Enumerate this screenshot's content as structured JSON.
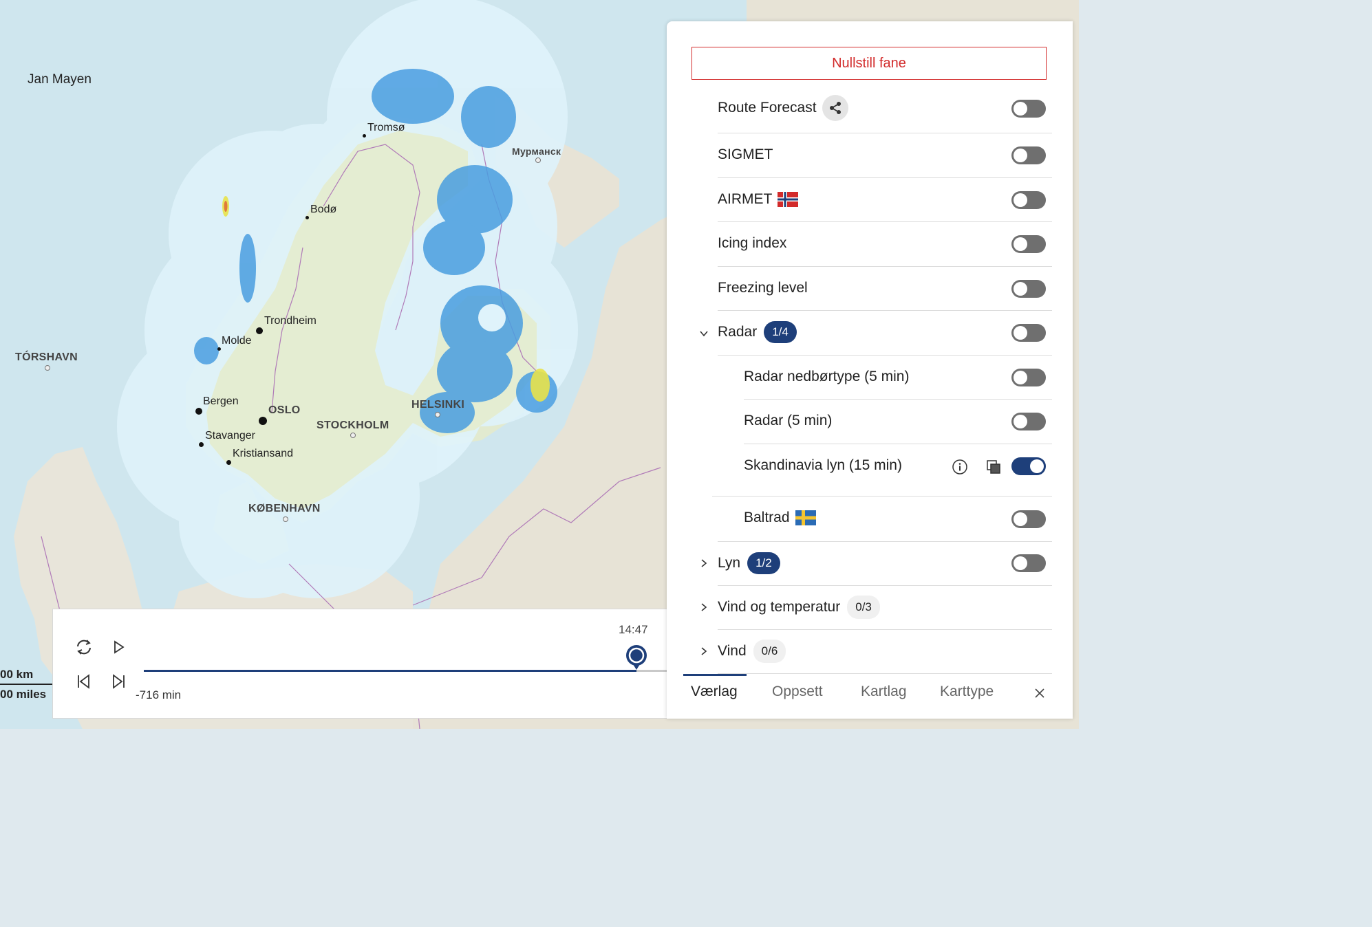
{
  "map": {
    "labels": {
      "jan_mayen": "Jan Mayen",
      "torshavn": "TÓRSHAVN",
      "tromso": "Tromsø",
      "murmansk": "Мурманск",
      "bodo": "Bodø",
      "trondheim": "Trondheim",
      "molde": "Molde",
      "bergen": "Bergen",
      "oslo": "OSLO",
      "stockholm": "STOCKHOLM",
      "helsinki": "HELSINKI",
      "stavanger": "Stavanger",
      "kristiansand": "Kristiansand",
      "kobenhavn": "KØBENHAVN"
    },
    "scale": {
      "km": "00 km",
      "miles": "00 miles"
    },
    "colors": {
      "sea": "#cfe6ee",
      "land": "#ece9df",
      "radar_coverage": "#dff3fb",
      "precip_light": "#4a9ee0",
      "precip_heavy": "#e8e24a",
      "border": "#b07ab8"
    }
  },
  "timeline": {
    "current_time": "14:47",
    "start_label": "-716 min",
    "progress_fraction": 1.0,
    "icons": {
      "loop": "loop-icon",
      "play": "play-icon",
      "step_back": "step-back-icon",
      "step_forward": "step-forward-icon"
    }
  },
  "panel": {
    "reset_label": "Nullstill fane",
    "layers": {
      "route_forecast": {
        "label": "Route Forecast",
        "on": false
      },
      "sigmet": {
        "label": "SIGMET",
        "on": false
      },
      "airmet": {
        "label": "AIRMET",
        "on": false
      },
      "icing": {
        "label": "Icing index",
        "on": false
      },
      "freezing": {
        "label": "Freezing level",
        "on": false
      },
      "radar": {
        "label": "Radar",
        "badge": "1/4",
        "on": false,
        "expanded": true
      },
      "radar_type": {
        "label": "Radar nedbørtype (5 min)",
        "on": false
      },
      "radar_5": {
        "label": "Radar (5 min)",
        "on": false
      },
      "skandinavia": {
        "label": "Skandinavia lyn (15 min)",
        "on": true
      },
      "baltrad": {
        "label": "Baltrad",
        "on": false
      },
      "lyn": {
        "label": "Lyn",
        "badge": "1/2",
        "on": false
      },
      "vind_temp": {
        "label": "Vind og temperatur",
        "badge": "0/3"
      },
      "vind": {
        "label": "Vind",
        "badge": "0/6"
      }
    },
    "tabs": {
      "vaerlag": "Værlag",
      "oppsett": "Oppsett",
      "kartlag": "Kartlag",
      "karttype": "Karttype"
    },
    "colors": {
      "accent": "#1e3f7a",
      "reset": "#d22b2b",
      "toggle_off": "#6f6f6f"
    }
  }
}
